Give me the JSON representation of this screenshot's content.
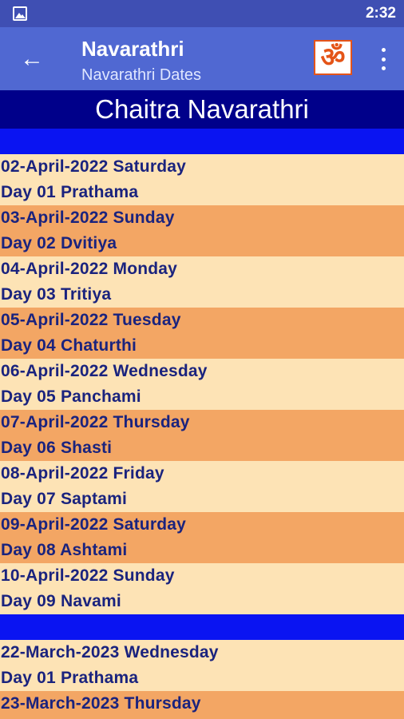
{
  "status_bar": {
    "time": "2:32"
  },
  "app_bar": {
    "title": "Navarathri",
    "subtitle": "Navarathri Dates",
    "back_icon": "←",
    "om_icon": "ॐ"
  },
  "heading": "Chaitra Navarathri",
  "colors": {
    "status_bar": "#3f4fb3",
    "app_bar": "#5068d2",
    "heading_bg": "#00008a",
    "separator": "#0a14f2",
    "row_light": "#fde3b5",
    "row_dark": "#f3a664",
    "text": "#1a237e"
  },
  "groups": [
    {
      "entries": [
        {
          "date": "02-April-2022 Saturday",
          "day": "Day 01 Prathama"
        },
        {
          "date": "03-April-2022 Sunday",
          "day": "Day 02 Dvitiya"
        },
        {
          "date": "04-April-2022 Monday",
          "day": "Day 03 Tritiya"
        },
        {
          "date": "05-April-2022 Tuesday",
          "day": "Day 04 Chaturthi"
        },
        {
          "date": "06-April-2022 Wednesday",
          "day": "Day 05 Panchami"
        },
        {
          "date": "07-April-2022 Thursday",
          "day": "Day 06 Shasti"
        },
        {
          "date": "08-April-2022 Friday",
          "day": "Day 07 Saptami"
        },
        {
          "date": "09-April-2022 Saturday",
          "day": "Day 08 Ashtami"
        },
        {
          "date": "10-April-2022 Sunday",
          "day": "Day 09 Navami"
        }
      ]
    },
    {
      "entries": [
        {
          "date": "22-March-2023 Wednesday",
          "day": "Day 01 Prathama"
        },
        {
          "date": "23-March-2023 Thursday",
          "day": ""
        }
      ]
    }
  ]
}
